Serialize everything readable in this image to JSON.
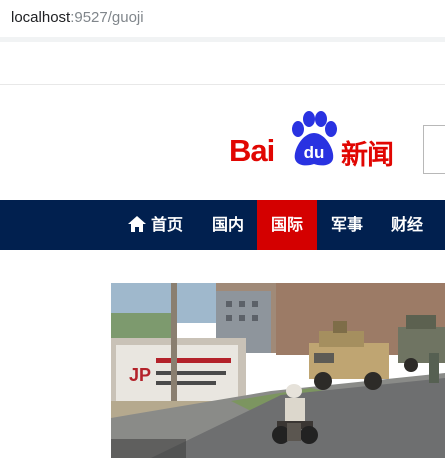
{
  "browser": {
    "url_host": "localhost",
    "url_rest": ":9527/guoji"
  },
  "logo": {
    "left_text": "Bai",
    "paw_text": "du",
    "right_text": "新闻",
    "color": "#e10602",
    "paw_color": "#2932e1"
  },
  "nav": {
    "background": "#01204f",
    "active_color": "#d40000",
    "items": [
      {
        "label": "首页",
        "icon": "home-icon"
      },
      {
        "label": "国内"
      },
      {
        "label": "国际",
        "active": true
      },
      {
        "label": "军事"
      },
      {
        "label": "财经"
      }
    ]
  },
  "news": {
    "image_description_icon": "news-photo"
  }
}
